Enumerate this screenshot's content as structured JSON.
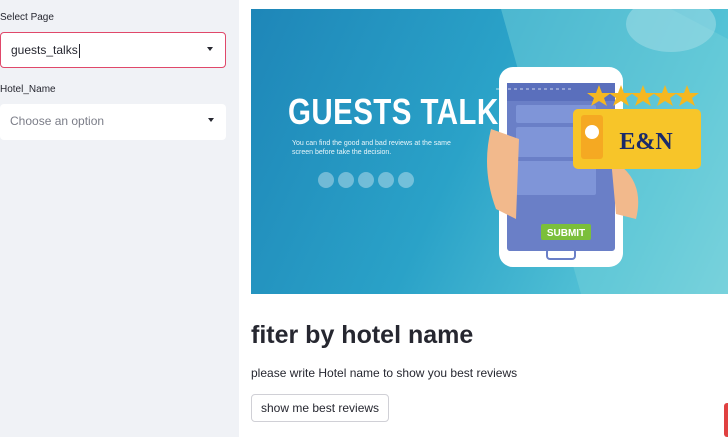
{
  "sidebar": {
    "select_page": {
      "label": "Select Page",
      "value": "guests_talks"
    },
    "hotel_name": {
      "label": "Hotel_Name",
      "placeholder": "Choose an option"
    }
  },
  "banner": {
    "title": "GUESTS TALK",
    "subtitle": "You can find the good and bad reviews at the same screen before take the decision.",
    "logo_text": "E&N",
    "submit_label": "SUBMIT",
    "stars": 5
  },
  "main": {
    "heading": "fiter by hotel name",
    "description": "please write Hotel name to show you best reviews",
    "button_label": "show me best reviews"
  },
  "colors": {
    "sidebar_bg": "#f0f2f6",
    "focus_border": "#e0486a",
    "banner_blue": "#1e86b8",
    "star": "#f5b720"
  }
}
